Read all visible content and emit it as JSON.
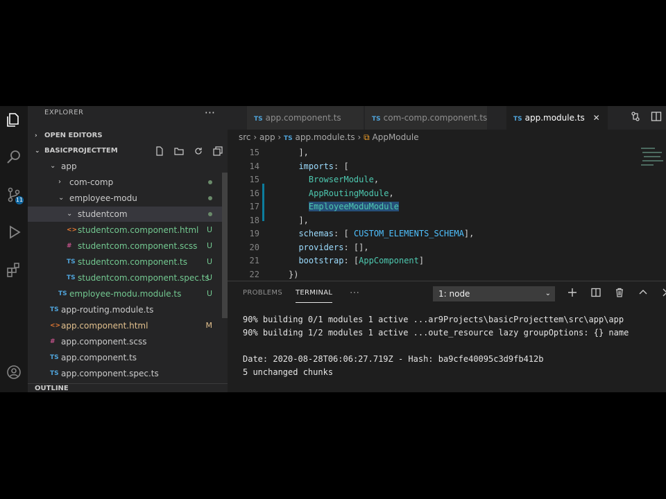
{
  "activity_bar": {
    "scm_badge": "11"
  },
  "sidebar": {
    "title": "EXPLORER",
    "more": "···",
    "open_editors": "OPEN EDITORS",
    "project": "BASICPROJECTTEM",
    "outline": "OUTLINE",
    "tree": [
      {
        "label": "app",
        "chevron": "⌄",
        "indent": 32
      },
      {
        "label": "com-comp",
        "chevron": "›",
        "indent": 44,
        "dot": true
      },
      {
        "label": "employee-modu",
        "chevron": "⌄",
        "indent": 44,
        "dot": true
      },
      {
        "label": "studentcom",
        "chevron": "⌄",
        "indent": 56,
        "selected": true,
        "dot": true
      },
      {
        "label": "studentcom.component.html",
        "icon": "<>",
        "indent": 56,
        "status": "U"
      },
      {
        "label": "studentcom.component.scss",
        "icon": "#",
        "indent": 56,
        "status": "U"
      },
      {
        "label": "studentcom.component.ts",
        "icon": "TS",
        "indent": 56,
        "status": "U"
      },
      {
        "label": "studentcom.component.spec.ts",
        "icon": "TS",
        "indent": 56,
        "status": "U"
      },
      {
        "label": "employee-modu.module.ts",
        "icon": "TS",
        "indent": 44,
        "status": "U"
      },
      {
        "label": "app-routing.module.ts",
        "icon": "TS",
        "indent": 32
      },
      {
        "label": "app.component.html",
        "icon": "<>",
        "indent": 32,
        "status": "M"
      },
      {
        "label": "app.component.scss",
        "icon": "#",
        "indent": 32
      },
      {
        "label": "app.component.ts",
        "icon": "TS",
        "indent": 32
      },
      {
        "label": "app.component.spec.ts",
        "icon": "TS",
        "indent": 32
      }
    ]
  },
  "tabs": [
    {
      "icon": "TS",
      "label": "app.component.ts",
      "active": false
    },
    {
      "icon": "TS",
      "label": "com-comp.component.ts",
      "active": false
    },
    {
      "icon": "TS",
      "label": "app.module.ts",
      "active": true,
      "close": "✕"
    }
  ],
  "breadcrumb": {
    "src": "src",
    "app": "app",
    "file_icon": "TS",
    "file": "app.module.ts",
    "symbol": "AppModule"
  },
  "editor": {
    "line_numbers": [
      "15",
      "14",
      "15",
      "16",
      "17",
      "18",
      "19",
      "20",
      "21",
      "22"
    ],
    "lines": [
      {
        "indent": "  ",
        "parts": [
          {
            "t": "],",
            "c": "pn"
          }
        ]
      },
      {
        "indent": "  ",
        "parts": [
          {
            "t": "imports",
            "c": "kw"
          },
          {
            "t": ": [",
            "c": "pn"
          }
        ]
      },
      {
        "indent": "    ",
        "parts": [
          {
            "t": "BrowserModule",
            "c": "cls"
          },
          {
            "t": ",",
            "c": "pn"
          }
        ]
      },
      {
        "indent": "    ",
        "parts": [
          {
            "t": "AppRoutingModule",
            "c": "cls"
          },
          {
            "t": ",",
            "c": "pn"
          }
        ]
      },
      {
        "indent": "    ",
        "parts": [
          {
            "t": "EmployeeModuModule",
            "c": "cls hl"
          }
        ]
      },
      {
        "indent": "  ",
        "parts": [
          {
            "t": "],",
            "c": "pn"
          }
        ]
      },
      {
        "indent": "  ",
        "parts": [
          {
            "t": "schemas",
            "c": "kw"
          },
          {
            "t": ": [ ",
            "c": "pn"
          },
          {
            "t": "CUSTOM_ELEMENTS_SCHEMA",
            "c": "con"
          },
          {
            "t": "],",
            "c": "pn"
          }
        ]
      },
      {
        "indent": "  ",
        "parts": [
          {
            "t": "providers",
            "c": "kw"
          },
          {
            "t": ": [],",
            "c": "pn"
          }
        ]
      },
      {
        "indent": "  ",
        "parts": [
          {
            "t": "bootstrap",
            "c": "kw"
          },
          {
            "t": ": [",
            "c": "pn"
          },
          {
            "t": "AppComponent",
            "c": "cls"
          },
          {
            "t": "]",
            "c": "pn"
          }
        ]
      },
      {
        "indent": "",
        "parts": [
          {
            "t": "})",
            "c": "pn"
          }
        ]
      }
    ]
  },
  "panel": {
    "tabs": [
      "PROBLEMS",
      "TERMINAL"
    ],
    "more": "···",
    "terminal_select": "1: node",
    "terminal_lines": [
      "90% building 0/1 modules 1 active ...ar9Projects\\basicProjecttem\\src\\app\\app",
      "90% building 1/2 modules 1 active ...oute_resource lazy groupOptions: {} name",
      "",
      "Date: 2020-08-28T06:06:27.719Z - Hash: ba9cfe40095c3d9fb412b",
      "5 unchanged chunks"
    ]
  },
  "colors": {
    "accent": "#0e639c",
    "ts": "#4fa3d9",
    "untracked": "#73c991",
    "selection": "#264f78"
  }
}
